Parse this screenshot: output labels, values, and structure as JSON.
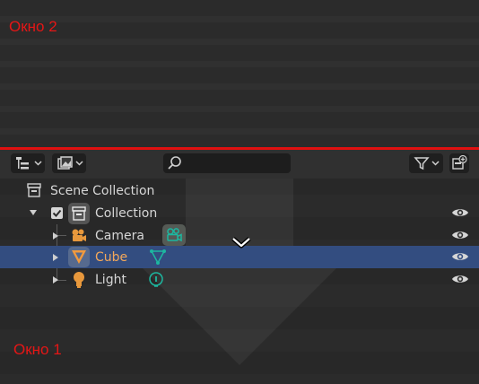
{
  "overlays": {
    "window2_label": "Окно 2",
    "window1_label": "Окно 1"
  },
  "colors": {
    "overlay_red": "#e51616",
    "selected_row": "#334d80",
    "camera_orange": "#e8983c",
    "data_teal": "#1db7a0",
    "cube_text": "#f3a85a"
  },
  "header": {
    "display_mode_icon": "outliner-display-mode-icon",
    "filter_view_icon": "image-filter-icon",
    "search": {
      "value": "",
      "placeholder": ""
    },
    "filter_icon": "funnel-icon",
    "new_collection_icon": "new-collection-icon"
  },
  "outliner": {
    "scene_collection": {
      "label": "Scene Collection",
      "icon": "scene-collection-icon"
    },
    "collection": {
      "label": "Collection",
      "icon": "collection-icon",
      "checked": true,
      "expanded": true,
      "visible": true
    },
    "objects": [
      {
        "label": "Camera",
        "icon": "camera-object-icon",
        "data_icon": "camera-data-icon",
        "selected": false,
        "visible": true
      },
      {
        "label": "Cube",
        "icon": "mesh-object-icon",
        "data_icon": "mesh-data-icon",
        "selected": true,
        "visible": true
      },
      {
        "label": "Light",
        "icon": "light-object-icon",
        "data_icon": "light-data-icon",
        "selected": false,
        "visible": true
      }
    ]
  }
}
